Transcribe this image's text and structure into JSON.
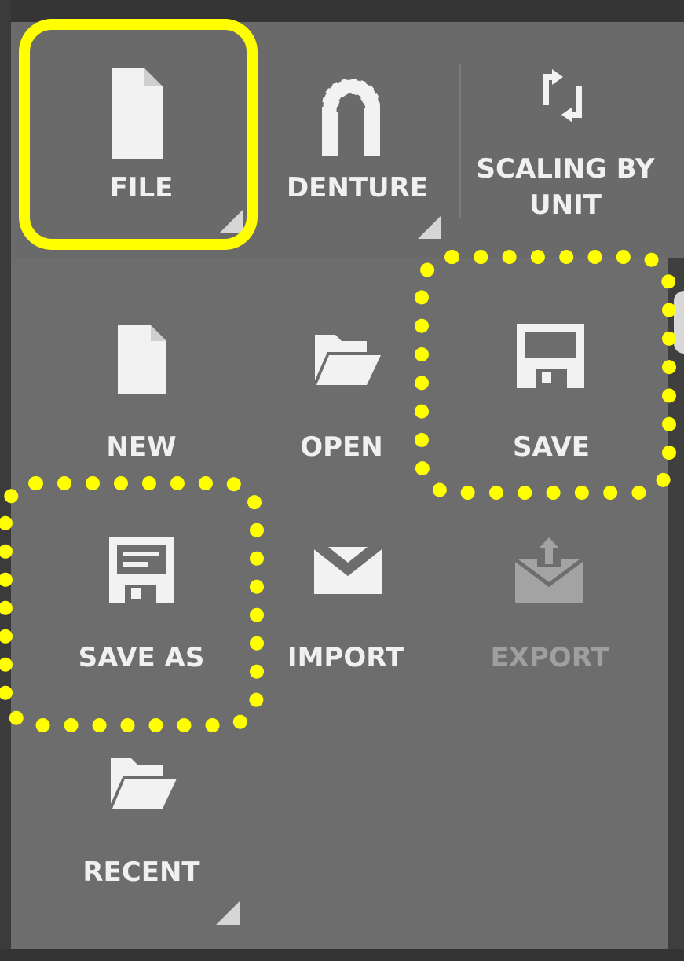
{
  "ribbon": {
    "file_label": "FILE",
    "denture_label": "DENTURE",
    "scaling_label_line1": "SCALING BY",
    "scaling_label_line2": "UNIT"
  },
  "file_menu": {
    "new_label": "NEW",
    "open_label": "OPEN",
    "save_label": "SAVE",
    "save_as_label": "SAVE AS",
    "import_label": "IMPORT",
    "export_label": "EXPORT",
    "recent_label": "RECENT"
  },
  "icons": {
    "file": "document-icon",
    "denture": "denture-arch-icon",
    "scaling": "convert-arrows-icon",
    "new": "new-document-icon",
    "open": "open-folder-icon",
    "save": "floppy-disk-icon",
    "save_as": "floppy-disk-lines-icon",
    "import": "envelope-import-icon",
    "export": "envelope-export-icon",
    "recent": "folder-icon"
  },
  "colors": {
    "highlight": "#ffff00",
    "panel": "#6d6d6d",
    "text": "#f0f0f0",
    "disabled_text": "#9f9f9f",
    "icon": "#f2f2f2",
    "disabled_icon": "#a3a3a3"
  }
}
